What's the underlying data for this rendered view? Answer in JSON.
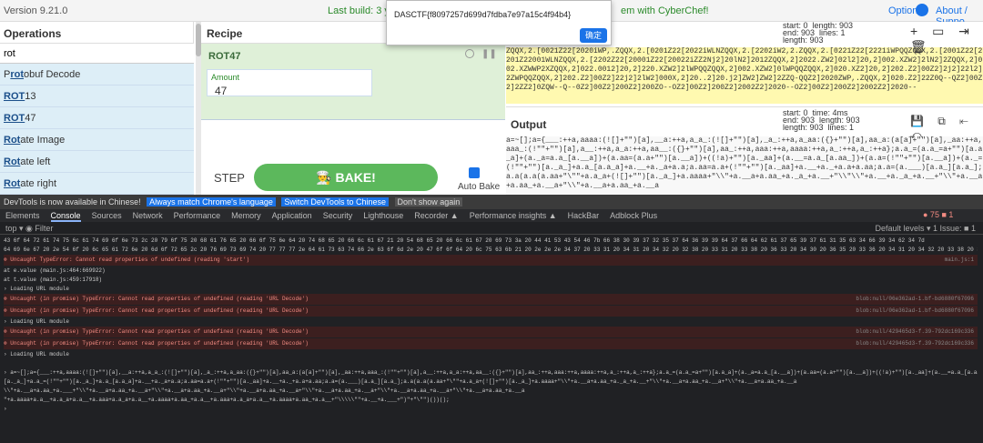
{
  "topbar": {
    "version": "Version 9.21.0",
    "build": "Last build: 3 years",
    "with": "em with CyberChef!",
    "options": "Options",
    "about": "About / Suppo"
  },
  "ops": {
    "title": "Operations",
    "search": "rot",
    "items": [
      {
        "pre": "P",
        "mid": "rot",
        "post": "obuf Decode"
      },
      {
        "pre": "",
        "mid": "ROT",
        "post": "13"
      },
      {
        "pre": "",
        "mid": "ROT",
        "post": "47"
      },
      {
        "pre": "",
        "mid": "Rot",
        "post": "ate Image"
      },
      {
        "pre": "",
        "mid": "Rot",
        "post": "ate left"
      },
      {
        "pre": "",
        "mid": "Rot",
        "post": "ate right"
      }
    ]
  },
  "recipe": {
    "title": "Recipe",
    "op": "ROT47",
    "amount_label": "Amount",
    "amount": "47",
    "step": "STEP",
    "bake": "BAKE!",
    "autobake": "Auto Bake"
  },
  "input": {
    "meta": "start: 0  length: 903\nend: 903  lines: 1\nlength: 903",
    "icons": "+ ▭ ⇥ 🗑",
    "text": "ZQQX,2.[0021Z22[2020iWP,.ZQQX,2.[0201Z22[2022iWLNZQQX,2.[2202iW2,2.ZQQX,2.[0221Z22[2221iWPQQZQQX,2.[2001Z22[2201Z22001WLNZQQX,2.[2202Z22[20001Z22[20022iZZ2Nj2]20lN2]2012ZQQX,2]2022.ZW2]02l2]20,2]002.XZW2]2lN2]2ZQQX,2]002.XZWWP2XZQQX,2]022.0012]20,2]220.XZW2]2lWPQQZQQX,2]002.XZW2]0lWPQQZQQX,2]020.XZ2]20,2]202.Z2]00Z2]2j2]22l2]2ZWPQQZQQX,2]202.Z2]00Z2]22j2]2lW2]000X,2]20..2]20.j2]ZW2]ZW2]2ZZQ-QQZ2]2020ZWP,.ZQQX,2]020.Z2]22Z0Q--QZ2]00Z2]2ZZ2]0ZQW--Q--0Z2]00Z2]200Z2]200ZO--OZ2]00Z2]200Z2]2002Z2]2020--OZ2]00Z2]200Z2]2002Z2]2020--"
  },
  "output": {
    "title": "Output",
    "meta": "start: 0  time: 4ms\nend: 903  length: 903\nlength: 903  lines: 1",
    "text": "a=~[];a={___:++a,aaaa:(![]+\"\")[a],__a:++a,a_a_:(![]+\"\")[a],_a_:++a,a_aa:({}+\"\")[a],aa_a:(a[a]+\"\")[a],_aa:++a,aaa_:(!\"\"+\"\")[a],a__:++a,a_a:++a,aa__:({}+\"\")[a],aa_:++a,aaa:++a,aaaa:++a,a_:++a,a_:++a};a.a_=(a.a_=a+\"\")[a.a_a]+(a._a=a.a_[a.__a])+(a.aa=(a.a+\"\")[a.__a])+((!a)+\"\")[a._aa]+(a.__=a.a_[a.aa_])+(a.a=(!\"\"+\"\")[a.__a])+(a._=(!\"\"+\"\")[a._a_]+a.a_[a.a_a]+a.__+a._a+a.a;a.aa=a.a+(!\"\"+\"\")[a._aa]+a.__+a._+a.a+a.aa;a.a=(a.___)[a.a_][a.a_];a.a(a.a(a.aa+\"\\\"\"+a.a_a+(![]+\"\")[a._a_]+a.aaaa+\"\\\\\"+a.__a+a.aa_+a._a_+a.__+\"\\\\\"\\\\\"+a.__+a._a_+a.__+\"\\\\\"+a.__a+a.aa_+a.__a+\"\\\\\"+a.__a+a.aa_+a.__a"
  },
  "alert": {
    "text": "DASCTF{f8097257d699d7fdba7e97a15c4f94b4}",
    "ok": "确定"
  },
  "devtools": {
    "notice": "DevTools is now available in Chinese!",
    "btn1": "Always match Chrome's language",
    "btn2": "Switch DevTools to Chinese",
    "btn3": "Don't show again",
    "tabs": [
      "Elements",
      "Console",
      "Sources",
      "Network",
      "Performance",
      "Memory",
      "Application",
      "Security",
      "Lighthouse",
      "Recorder ▲",
      "Performance insights ▲",
      "HackBar",
      "Adblock Plus"
    ],
    "errcount": "● 75  ■ 1",
    "filter": "top ▾   ◉   Filter",
    "levels": "Default levels ▾   1 Issue: ■ 1",
    "lines": [
      {
        "t": "info",
        "text": "43 6f 64 72 61 74 75 6c 61 74 69 6f 6e 73 2c 20 79 6f 75 20 68 61 76 65 20 66 6f 75 6e 64 20 74 68 65 20 66 6c 61 67 21 20 54 68 65 20 66 6c 61 67 20 69 73 3a 20 44 41 53 43 54 46 7b 66 38 30 39 37 32 35 37 64 36 39 39 64 37 66 64 62 61 37 65 39 37 61 31 35 63 34 66 39 34 62 34 7d"
      },
      {
        "t": "info",
        "text": "64 69 6e 67 20 2e 54 6f 20 6c 65 61 72 6e 20 6d 6f 72 65 2c 20 76 69 73 69 74 20 77 77 77 2e 64 61 73 63 74 66 2e 63 6f 6d 2e 20 47 6f 6f 64 20 6c 75 63 6b 21 20 2e 2e 2e 34 37 20 33 31 20 34 31 20 34 32 20 32 38 20 33 31 20 33 38 20 36 33 20 34 30 20 36 35 20 33 36 20 34 31 20 34 32 20 33 38 20 33 38 20 36 35 20 33 36 20 34 31"
      },
      {
        "t": "err",
        "text": "⊗ Uncaught TypeError: Cannot read properties of undefined (reading 'start')",
        "src": "main.js:1"
      },
      {
        "t": "info",
        "text": "      at e.value (main.js:464:669922)"
      },
      {
        "t": "info",
        "text": "      at t.value (main.js:459:17918)"
      },
      {
        "t": "info",
        "text": "› Loading URL module"
      },
      {
        "t": "err",
        "text": "⊗ Uncaught (in promise) TypeError: Cannot read properties of undefined (reading 'URL Decode')",
        "src": "blob:null/06e362ad-1.bf-bd6880f67096"
      },
      {
        "t": "err",
        "text": "⊗ Uncaught (in promise) TypeError: Cannot read properties of undefined (reading 'URL Decode')",
        "src": "blob:null/06e362ad-1.bf-bd6880f67096"
      },
      {
        "t": "info",
        "text": "› Loading URL module"
      },
      {
        "t": "err",
        "text": "⊗ Uncaught (in promise) TypeError: Cannot read properties of undefined (reading 'URL Decode')",
        "src": "blob:null/429465d3-f.39-792dc169c336"
      },
      {
        "t": "err",
        "text": "⊗ Uncaught (in promise) TypeError: Cannot read properties of undefined (reading 'URL Decode')",
        "src": "blob:null/429465d3-f.39-792dc169c336"
      },
      {
        "t": "info",
        "text": "› Loading URL module"
      },
      {
        "t": "info",
        "text": ""
      },
      {
        "t": "info",
        "text": "› a=~[];a={___:++a,aaaa:(![]+\"\")[a],__a:++a,a_a_:(![]+\"\")[a],_a_:++a,a_aa:({}+\"\")[a],aa_a:(a[a]+\"\")[a],_aa:++a,aaa_:(!\"\"+\"\")[a],a__:++a,a_a:++a,aa__:({}+\"\")[a],aa_:++a,aaa:++a,aaaa:++a,a_:++a,a_:++a};a.a_=(a.a_=a+\"\")[a.a_a]+(a._a=a.a_[a.__a])+(a.aa=(a.a+\"\")[a.__a])+((!a)+\"\")[a._aa]+(a.__=a.a_[a.aa_])+(a.a=(!\"\"+\"\")[a.__a])"
      },
      {
        "t": "info",
        "text": "  [a._a_]+a.a_=(!\"\"+\"\")[a._a_]+a.a_[a.a_a]+a.__+a._a+a.a;a.aa=a.a+(!\"\"+\"\")[a._aa]+a.__+a._+a.a+a.aa;a.a=(a.___)[a.a_][a.a_];a.a(a.a(a.aa+\"\\\"\"+a.a_a+(![]+\"\")[a._a_]+a.aaaa+\"\\\\\"+a.__a+a.aa_+a._a_+a.__+\"\\\\\"+a.__a+a.aa_+a.__a+\"\\\\\"+a.__a+a.aa_+a.__a"
      },
      {
        "t": "info",
        "text": "  \\\\\"+a.__a+a.aa_+a.___+\"\\\\\"+a.__a+a.aa_+a.__a+\"\\\\\"+a.__a+a.aa_+a.__a+\"\\\\\"+a.__a+a.aa_+a.__a+\"\\\\\"+a.__a+a.aa_+a.__a+\"\\\\\"+a.__a+a.aa_+a.__a+\"\\\\\"+a.__a+a.aa_+a.__a"
      },
      {
        "t": "info",
        "text": "  \"+a.aaaa+a.a__+a.a_a+a.a__+a.aaa+a.a_a+a.a__+a.aaaa+a.aa_+a.a__+a.aaa+a.a_a+a.a__+a.aaaa+a.aa_+a.a__+\"\\\\\\\\\\\"\"+a.__+a.___+\")\"+\"\\\"\")())();"
      },
      {
        "t": "info",
        "text": "› "
      }
    ]
  }
}
